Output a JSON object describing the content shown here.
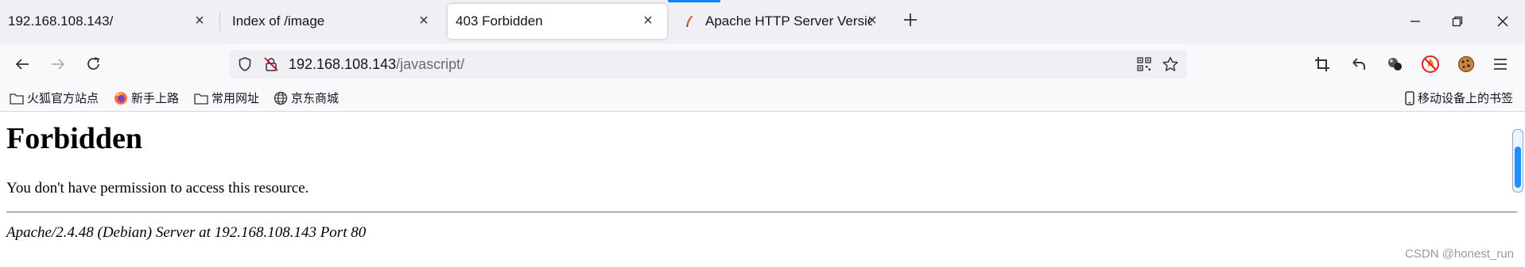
{
  "tabs": [
    {
      "label": "192.168.108.143/",
      "close_icon": "close-icon",
      "active": false
    },
    {
      "label": "Index of /image",
      "close_icon": "close-icon",
      "active": false
    },
    {
      "label": "403 Forbidden",
      "close_icon": "close-icon",
      "active": true
    },
    {
      "label": "Apache HTTP Server Version",
      "favicon": "apache-feather-icon",
      "close_icon": "close-icon",
      "active": false
    }
  ],
  "window_controls": [
    "minimize-icon",
    "restore-icon",
    "close-icon"
  ],
  "nav": {
    "url_host": "192.168.108.143",
    "url_path": "/javascript/"
  },
  "bookmarks": [
    {
      "label": "火狐官方站点",
      "icon": "folder-icon"
    },
    {
      "label": "新手上路",
      "icon": "firefox-icon"
    },
    {
      "label": "常用网址",
      "icon": "folder-icon"
    },
    {
      "label": "京东商城",
      "icon": "globe-icon"
    }
  ],
  "mobile_bookmarks": {
    "label": "移动设备上的书签",
    "icon": "mobile-icon"
  },
  "page": {
    "heading": "Forbidden",
    "message": "You don't have permission to access this resource.",
    "address": "Apache/2.4.48 (Debian) Server at 192.168.108.143 Port 80"
  },
  "watermark": "CSDN @honest_run",
  "colors": {
    "accent": "#0a84ff",
    "scroll_thumb": "#1e90ff"
  }
}
